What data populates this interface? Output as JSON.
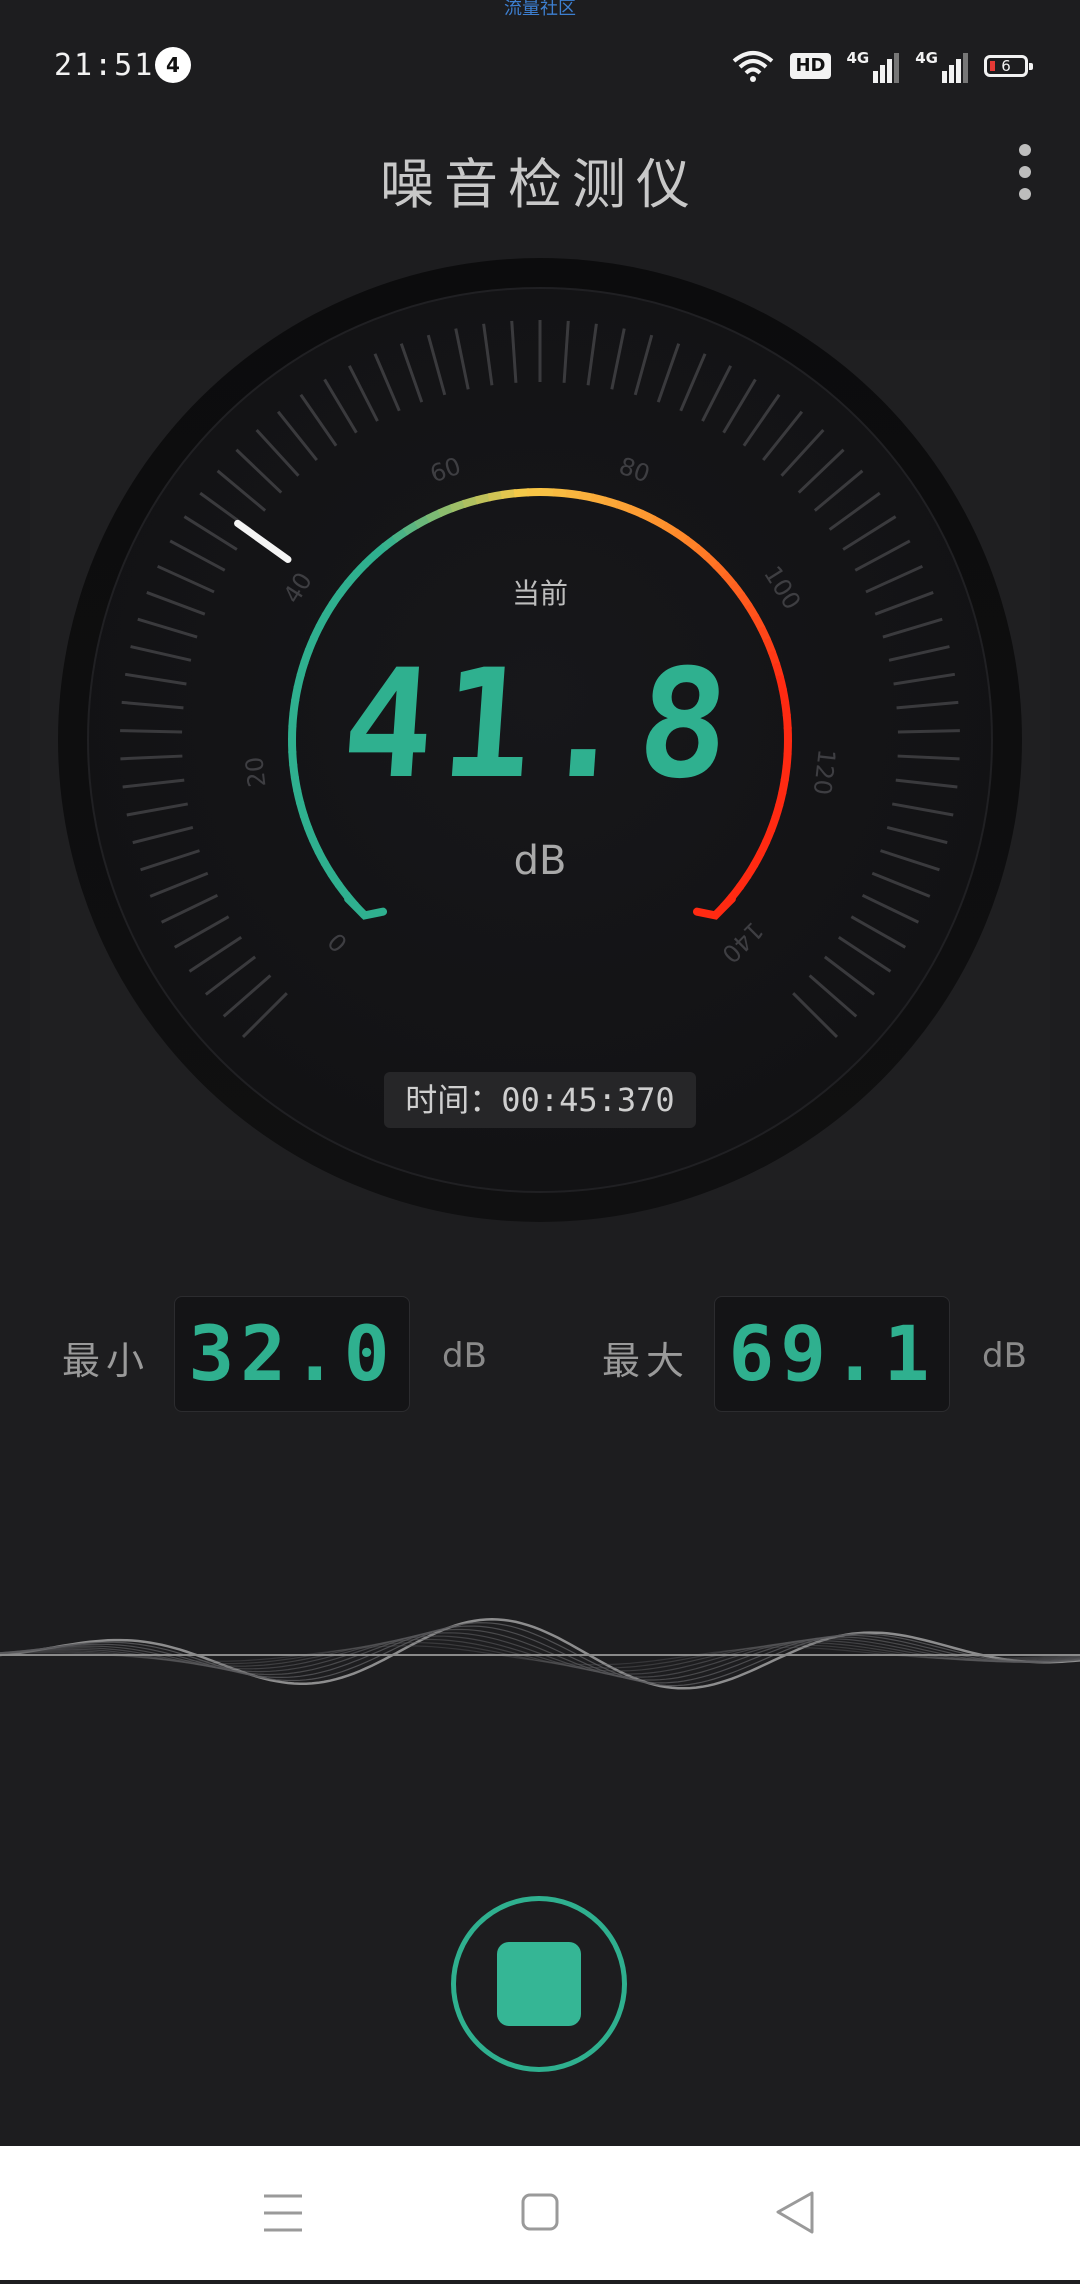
{
  "status_bar": {
    "top_caption": "流量社区",
    "time": "21:51",
    "notification_count": "4",
    "hd_label": "HD",
    "net1_label": "4G",
    "net2_label": "4G",
    "battery_level": "6",
    "icons": [
      "wifi-icon",
      "hd-icon",
      "signal-4g-icon",
      "signal-4g-icon",
      "battery-icon"
    ]
  },
  "header": {
    "title": "噪音检测仪",
    "menu_icon": "more-vertical-icon"
  },
  "gauge": {
    "current_label": "当前",
    "current_value": "41.8",
    "unit": "dB",
    "scale_labels": [
      "0",
      "20",
      "40",
      "60",
      "80",
      "100",
      "120",
      "140"
    ],
    "scale_min": 0,
    "scale_max": 140,
    "needle_value": 41.8,
    "timer": "时间：00:45:370",
    "colors": {
      "green": "#2fb08f",
      "yellow": "#f7c948",
      "orange": "#ff8a2a",
      "red": "#ff2a12"
    }
  },
  "stats": {
    "min_label": "最小",
    "min_value": "32.0",
    "max_label": "最大",
    "max_value": "69.1",
    "unit": "dB"
  },
  "controls": {
    "stop_icon": "stop-icon"
  },
  "nav_bar": {
    "icons": [
      "menu-icon",
      "home-icon",
      "back-icon"
    ]
  }
}
